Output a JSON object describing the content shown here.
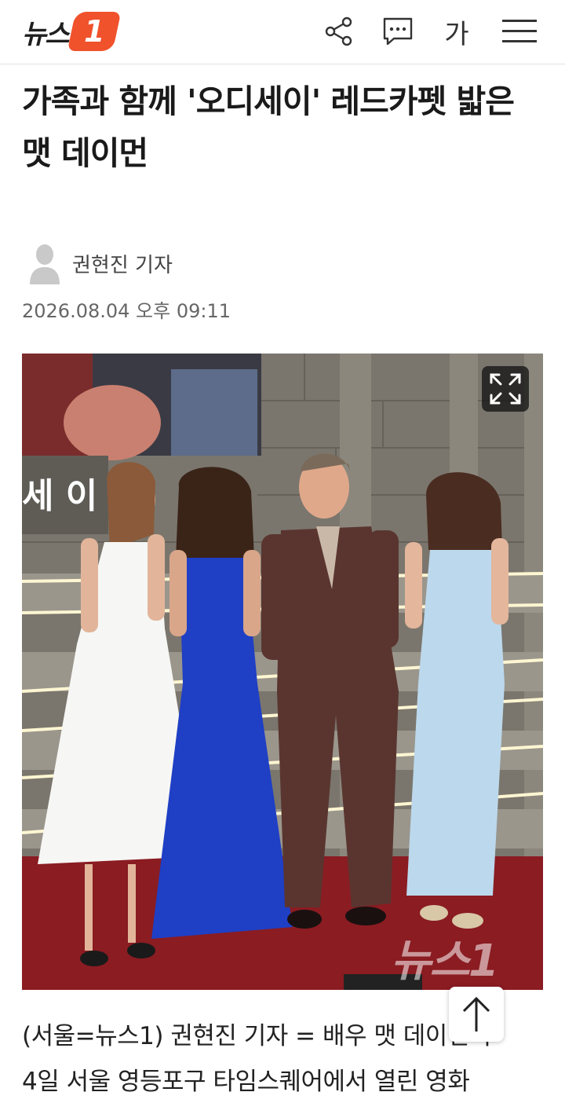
{
  "header": {
    "logo_text": "뉴스",
    "logo_badge": "1",
    "font_size_label": "가",
    "icons": [
      "share-icon",
      "comment-icon",
      "font-size-icon",
      "menu-icon"
    ]
  },
  "article": {
    "title": "가족과 함께 '오디세이' 레드카펫 밟은 맷 데이먼",
    "author": "권현진 기자",
    "date": "2026.08.04 오후 09:11",
    "photo_watermark": "뉴스1",
    "photo_sign_text": "세 이",
    "body_line1": "(서울=뉴스1) 권현진 기자 = 배우 맷 데이먼이",
    "body_line2": "4일 서울 영등포구 타임스퀘어에서 열린 영화"
  },
  "colors": {
    "brand": "#f0522c",
    "red_carpet": "#8a1c22",
    "blue_dress": "#1f3fc4",
    "suit": "#5a3530"
  }
}
